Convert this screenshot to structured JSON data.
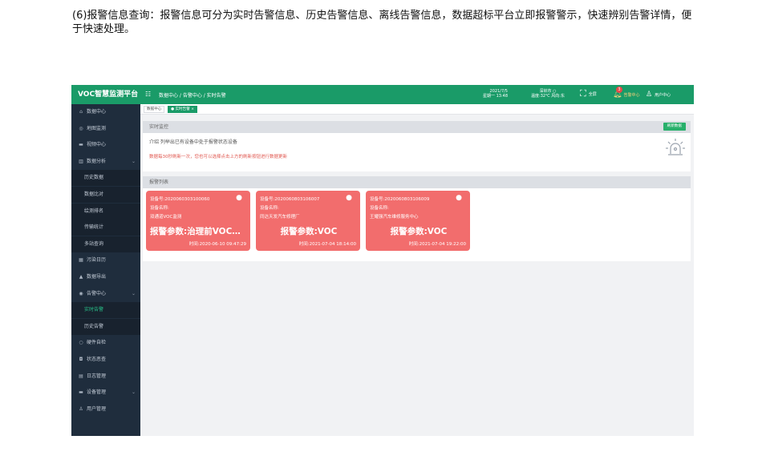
{
  "caption": "(6)报警信息查询：报警信息可分为实时告警信息、历史告警信息、离线告警信息，数据超标平台立即报警警示，快速辨别告警详情，便于快速处理。",
  "app": {
    "brand": "VOC智慧监测平台",
    "sidebar": [
      {
        "icon": "home-icon",
        "glyph": "⌂",
        "label": "数据中心",
        "sub": false,
        "active": false,
        "caret": false
      },
      {
        "icon": "map-pin-icon",
        "glyph": "◎",
        "label": "地图监测",
        "sub": false,
        "active": false,
        "caret": false
      },
      {
        "icon": "video-icon",
        "glyph": "▬",
        "label": "视频中心",
        "sub": false,
        "active": false,
        "caret": false
      },
      {
        "icon": "bar-chart-icon",
        "glyph": "▥",
        "label": "数据分析",
        "sub": false,
        "active": false,
        "caret": true
      },
      {
        "icon": "",
        "glyph": "",
        "label": "历史数据",
        "sub": true,
        "active": false,
        "caret": false
      },
      {
        "icon": "",
        "glyph": "",
        "label": "数据比对",
        "sub": true,
        "active": false,
        "caret": false
      },
      {
        "icon": "",
        "glyph": "",
        "label": "绘测排名",
        "sub": true,
        "active": false,
        "caret": false
      },
      {
        "icon": "",
        "glyph": "",
        "label": "传输统计",
        "sub": true,
        "active": false,
        "caret": false
      },
      {
        "icon": "",
        "glyph": "",
        "label": "多站查询",
        "sub": true,
        "active": false,
        "caret": false
      },
      {
        "icon": "calendar-icon",
        "glyph": "▦",
        "label": "污染日历",
        "sub": false,
        "active": false,
        "caret": false
      },
      {
        "icon": "export-icon",
        "glyph": "▲",
        "label": "数据导出",
        "sub": false,
        "active": false,
        "caret": false
      },
      {
        "icon": "alarm-icon",
        "glyph": "◉",
        "label": "告警中心",
        "sub": false,
        "active": false,
        "caret": true
      },
      {
        "icon": "",
        "glyph": "",
        "label": "实时告警",
        "sub": true,
        "active": true,
        "caret": false
      },
      {
        "icon": "",
        "glyph": "",
        "label": "历史告警",
        "sub": true,
        "active": false,
        "caret": false
      },
      {
        "icon": "hardware-icon",
        "glyph": "○",
        "label": "硬件自检",
        "sub": false,
        "active": false,
        "caret": false
      },
      {
        "icon": "status-icon",
        "glyph": "◘",
        "label": "状态恶查",
        "sub": false,
        "active": false,
        "caret": false
      },
      {
        "icon": "log-icon",
        "glyph": "▤",
        "label": "日志管理",
        "sub": false,
        "active": false,
        "caret": false
      },
      {
        "icon": "device-icon",
        "glyph": "▬",
        "label": "设备管理",
        "sub": false,
        "active": false,
        "caret": true
      },
      {
        "icon": "user-icon",
        "glyph": "♙",
        "label": "用户管理",
        "sub": false,
        "active": false,
        "caret": false
      }
    ],
    "header": {
      "breadcrumb": "数据中心 / 告警中心 / 实时告警",
      "date": "2021/7/5",
      "time": "星期一 13:48",
      "location": "深圳市 ○",
      "weather": "温度:32℃ 风向:东",
      "fullscreen": "全屏",
      "alarm_label": "告警中心",
      "alarm_count": "3",
      "user": "用户中心"
    },
    "tabs": [
      "数据中心",
      "● 实时告警 ×"
    ],
    "monitor": {
      "title": "实时监控",
      "refresh": "刷新数据",
      "intro": "介绍  列举出已有设备中处于报警状态设备",
      "note": "数据每30秒刷新一次，您也可以选择点击上方的刷新按钮进行数据更新"
    },
    "alarm_list": {
      "title": "报警列表",
      "cards": [
        {
          "device_no": "设备号:2020060303100060",
          "name_label": "设备名称:",
          "name": "双通道VOC监测",
          "param": "报警参数:治理前VOC，...",
          "time": "时间:2020-06-10 09:47:29"
        },
        {
          "device_no": "设备号:2020060803106007",
          "name_label": "设备名称:",
          "name": "同达天发汽车修理厂",
          "param": "报警参数:VOC",
          "time": "时间:2021-07-04 18:14:00"
        },
        {
          "device_no": "设备号:2020060803106009",
          "name_label": "设备名称:",
          "name": "王耀强汽车维修服务中心",
          "param": "报警参数:VOC",
          "time": "时间:2021-07-04 19:22:00"
        }
      ]
    }
  }
}
